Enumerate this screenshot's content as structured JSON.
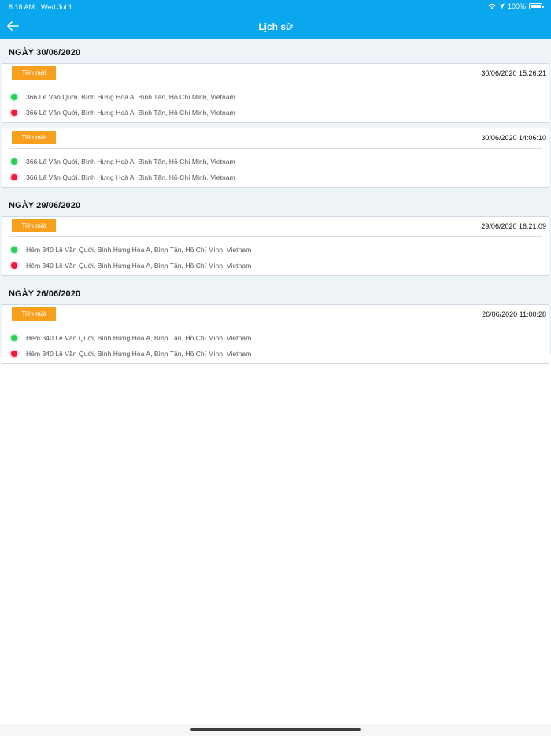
{
  "status_bar": {
    "time": "8:18 AM",
    "date": "Wed Jul 1",
    "battery": "100%"
  },
  "header": {
    "title": "Lịch sử",
    "back_icon": "arrow-left-icon",
    "background": "#0aa6ee"
  },
  "colors": {
    "badge": "#f6a01e",
    "pickup_dot": "#25d15b",
    "dropoff_dot": "#ee1b3a",
    "list_background": "#eef3f8"
  },
  "groups": [
    {
      "date_label": "NGÀY 30/06/2020",
      "trips": [
        {
          "payment": "Tiền mặt",
          "time": "30/06/2020 15:26:21",
          "pickup": "366 Lê Văn Quới, Bình Hưng Hoà A, Bình Tân, Hồ Chí Minh, Vietnam",
          "dropoff": "366 Lê Văn Quới, Bình Hưng Hoà A, Bình Tân, Hồ Chí Minh, Vietnam"
        },
        {
          "payment": "Tiền mặt",
          "time": "30/06/2020 14:06:10",
          "pickup": "366 Lê Văn Quới, Bình Hưng Hoà A, Bình Tân, Hồ Chí Minh, Vietnam",
          "dropoff": "366 Lê Văn Quới, Bình Hưng Hoà A, Bình Tân, Hồ Chí Minh, Vietnam"
        }
      ]
    },
    {
      "date_label": "NGÀY 29/06/2020",
      "trips": [
        {
          "payment": "Tiền mặt",
          "time": "29/06/2020 16:21:09",
          "pickup": "Hẻm 340 Lê Văn Quới, Bình Hưng Hòa A, Bình Tân, Hồ Chí Minh, Vietnam",
          "dropoff": "Hẻm 340 Lê Văn Quới, Bình Hưng Hòa A, Bình Tân, Hồ Chí Minh, Vietnam"
        }
      ]
    },
    {
      "date_label": "NGÀY 26/06/2020",
      "trips": [
        {
          "payment": "Tiền mặt",
          "time": "26/06/2020 11:00:28",
          "pickup": "Hẻm 340 Lê Văn Quới, Bình Hưng Hòa A, Bình Tân, Hồ Chí Minh, Vietnam",
          "dropoff": "Hẻm 340 Lê Văn Quới, Bình Hưng Hòa A, Bình Tân, Hồ Chí Minh, Vietnam"
        }
      ]
    }
  ]
}
